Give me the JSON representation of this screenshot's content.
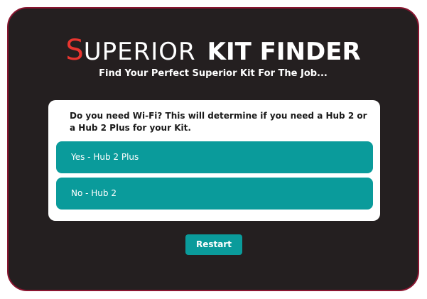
{
  "header": {
    "logo_s": "S",
    "logo_rest": "UPERIOR",
    "logo_bold": "KIT FINDER",
    "subtitle": "Find Your Perfect Superior Kit For The Job..."
  },
  "question": {
    "text": "Do you need Wi-Fi? This will determine if you need a Hub 2 or a Hub 2 Plus for your Kit.",
    "options": [
      {
        "label": "Yes - Hub 2 Plus"
      },
      {
        "label": "No - Hub 2"
      }
    ]
  },
  "restart_label": "Restart",
  "colors": {
    "background": "#241f20",
    "border": "#8a1530",
    "accent": "#0a9b9b",
    "logo_s": "#e8352f"
  }
}
